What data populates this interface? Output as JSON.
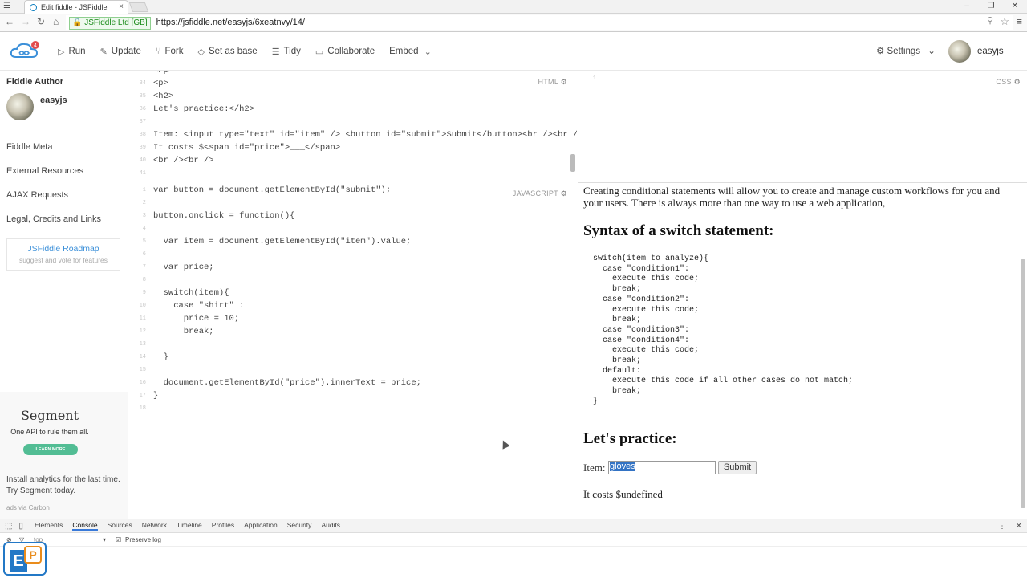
{
  "browser": {
    "tab_title": "Edit fiddle - JSFiddle",
    "secure_label": "JSFiddle Ltd [GB]",
    "url": "https://jsfiddle.net/easyjs/6xeatnvy/14/"
  },
  "header": {
    "notification_count": "4",
    "toolbar": [
      "Run",
      "Update",
      "Fork",
      "Set as base",
      "Tidy",
      "Collaborate",
      "Embed"
    ],
    "settings_label": "Settings",
    "username": "easyjs"
  },
  "sidebar": {
    "author_heading": "Fiddle Author",
    "author_name": "easyjs",
    "items": [
      "Fiddle Meta",
      "External Resources",
      "AJAX Requests",
      "Legal, Credits and Links"
    ],
    "roadmap_title": "JSFiddle Roadmap",
    "roadmap_sub": "suggest and vote for features",
    "ad": {
      "logo": "Segment",
      "tagline": "One API to rule them all.",
      "button": "LEARN MORE",
      "text": "Install analytics for the last time. Try Segment today.",
      "source": "ads via Carbon"
    }
  },
  "editors": {
    "html_label": "HTML",
    "css_label": "CSS",
    "js_label": "JAVASCRIPT",
    "html_lines": [
      {
        "n": "33",
        "t": "</p>"
      },
      {
        "n": "34",
        "t": "<p>"
      },
      {
        "n": "35",
        "t": "<h2>"
      },
      {
        "n": "36",
        "t": "Let's practice:</h2>"
      },
      {
        "n": "37",
        "t": ""
      },
      {
        "n": "38",
        "t": "Item: <input type=\"text\" id=\"item\" /> <button id=\"submit\">Submit</button><br /><br />"
      },
      {
        "n": "39",
        "t": "It costs $<span id=\"price\">___</span>"
      },
      {
        "n": "40",
        "t": "<br /><br />"
      },
      {
        "n": "41",
        "t": ""
      }
    ],
    "css_lines": [
      {
        "n": "1",
        "t": ""
      }
    ],
    "js_lines": [
      {
        "n": "1",
        "t": "var button = document.getElementById(\"submit\");"
      },
      {
        "n": "2",
        "t": ""
      },
      {
        "n": "3",
        "t": "button.onclick = function(){"
      },
      {
        "n": "4",
        "t": ""
      },
      {
        "n": "5",
        "t": "  var item = document.getElementById(\"item\").value;"
      },
      {
        "n": "6",
        "t": ""
      },
      {
        "n": "7",
        "t": "  var price;"
      },
      {
        "n": "8",
        "t": ""
      },
      {
        "n": "9",
        "t": "  switch(item){"
      },
      {
        "n": "10",
        "t": "    case \"shirt\" :"
      },
      {
        "n": "11",
        "t": "      price = 10;"
      },
      {
        "n": "12",
        "t": "      break;"
      },
      {
        "n": "13",
        "t": ""
      },
      {
        "n": "14",
        "t": "  }"
      },
      {
        "n": "15",
        "t": ""
      },
      {
        "n": "16",
        "t": "  document.getElementById(\"price\").innerText = price;"
      },
      {
        "n": "17",
        "t": "}"
      },
      {
        "n": "18",
        "t": ""
      }
    ]
  },
  "result": {
    "intro": "Creating conditional statements will allow you to create and manage custom workflows for you and your users. There is always more than one way to use a web application,",
    "syntax_heading": "Syntax of a switch statement:",
    "syntax_code": "switch(item to analyze){\n  case \"condition1\":\n    execute this code;\n    break;\n  case \"condition2\":\n    execute this code;\n    break;\n  case \"condition3\":\n  case \"condition4\":\n    execute this code;\n    break;\n  default:\n    execute this code if all other cases do not match;\n    break;\n}",
    "practice_heading": "Let's practice:",
    "item_label": "Item:",
    "item_value": "gloves",
    "submit_label": "Submit",
    "cost_text": "It costs $undefined"
  },
  "devtools": {
    "tabs": [
      "Elements",
      "Console",
      "Sources",
      "Network",
      "Timeline",
      "Profiles",
      "Application",
      "Security",
      "Audits"
    ],
    "active_tab": "Console",
    "context": "top",
    "preserve_log": "Preserve log"
  },
  "colors": {
    "accent": "#3a8fd9",
    "ad_button": "#52bd94",
    "selection": "#3373c4"
  }
}
